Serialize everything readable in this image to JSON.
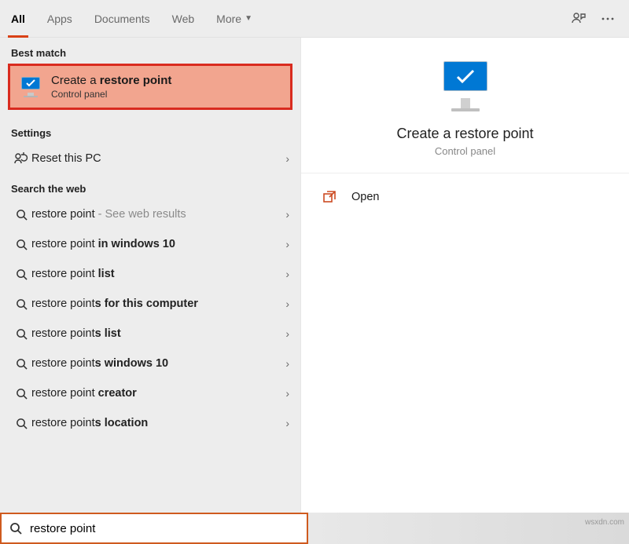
{
  "tabs": {
    "all": "All",
    "apps": "Apps",
    "documents": "Documents",
    "web": "Web",
    "more": "More"
  },
  "sections": {
    "best_match": "Best match",
    "settings": "Settings",
    "search_web": "Search the web"
  },
  "best_match": {
    "title_pre": "Create a ",
    "title_bold": "restore point",
    "subtitle": "Control panel"
  },
  "settings_items": [
    {
      "label": "Reset this PC"
    }
  ],
  "web_items": [
    {
      "pre": "restore point",
      "bold": "",
      "suffix": " - See web results"
    },
    {
      "pre": "restore point ",
      "bold": "in windows 10",
      "suffix": ""
    },
    {
      "pre": "restore point ",
      "bold": "list",
      "suffix": ""
    },
    {
      "pre": "restore point",
      "bold": "s for this computer",
      "suffix": ""
    },
    {
      "pre": "restore point",
      "bold": "s list",
      "suffix": ""
    },
    {
      "pre": "restore point",
      "bold": "s windows 10",
      "suffix": ""
    },
    {
      "pre": "restore point ",
      "bold": "creator",
      "suffix": ""
    },
    {
      "pre": "restore point",
      "bold": "s location",
      "suffix": ""
    }
  ],
  "detail": {
    "title": "Create a restore point",
    "subtitle": "Control panel",
    "open": "Open"
  },
  "search": {
    "value": "restore point"
  },
  "watermark": "wsxdn.com"
}
